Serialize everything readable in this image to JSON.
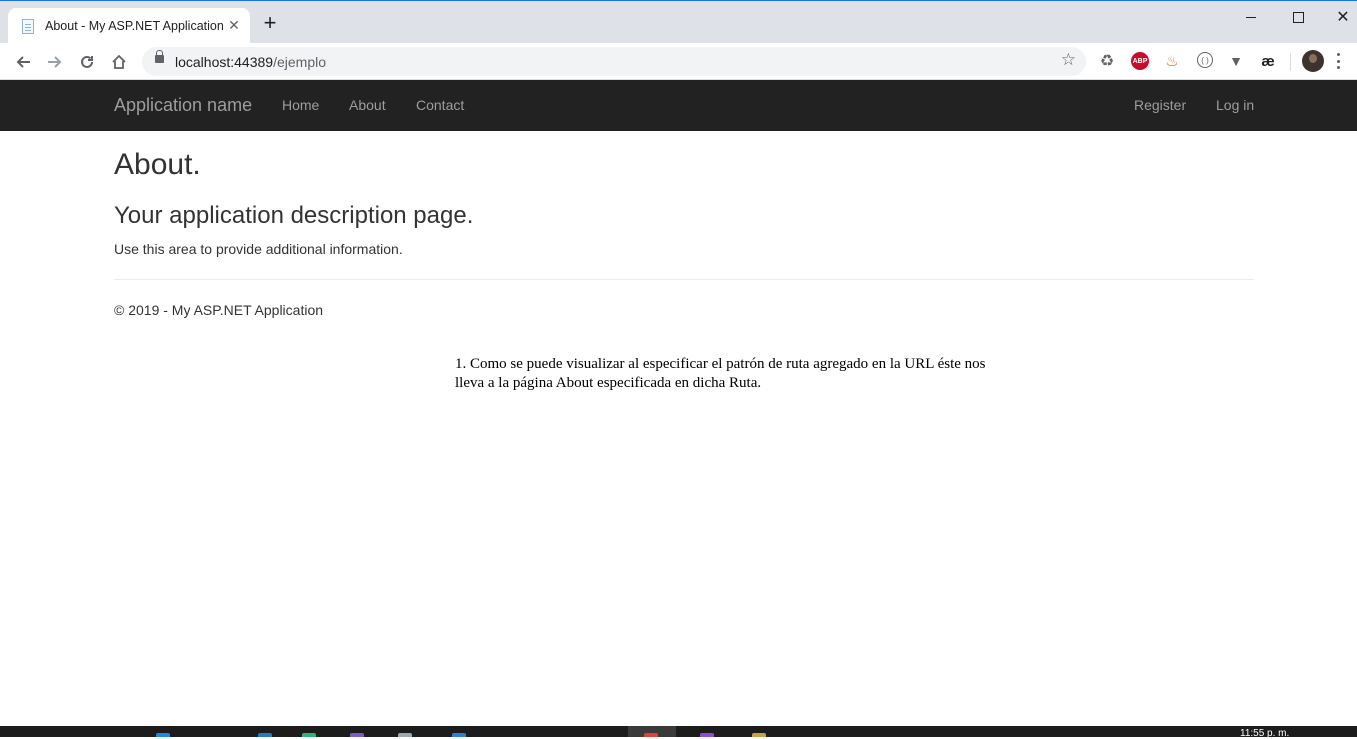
{
  "browser": {
    "tab_title": "About - My ASP.NET Application",
    "tab_close": "✕",
    "new_tab": "+",
    "url_host": "localhost:44389",
    "url_path": "/ejemplo",
    "extensions": [
      "recycle-icon",
      "adblock-plus-icon",
      "fire-icon",
      "bracket-icon",
      "vue-devtools-icon",
      "ae-icon"
    ],
    "abp_label": "ABP",
    "ae_label": "æ",
    "accent": "#1a73e8"
  },
  "navbar": {
    "brand": "Application name",
    "links": [
      "Home",
      "About",
      "Contact"
    ],
    "right_links": [
      "Register",
      "Log in"
    ]
  },
  "main": {
    "title": "About.",
    "subtitle": "Your application description page.",
    "paragraph": "Use this area to provide additional information."
  },
  "footer": {
    "copyright": "© 2019 - My ASP.NET Application"
  },
  "note": {
    "text": "1. Como se puede visualizar al especificar el patrón de ruta agregado en la URL éste nos lleva a la página About especificada en dicha Ruta."
  },
  "taskbar": {
    "clock": "11:55 p. m."
  }
}
